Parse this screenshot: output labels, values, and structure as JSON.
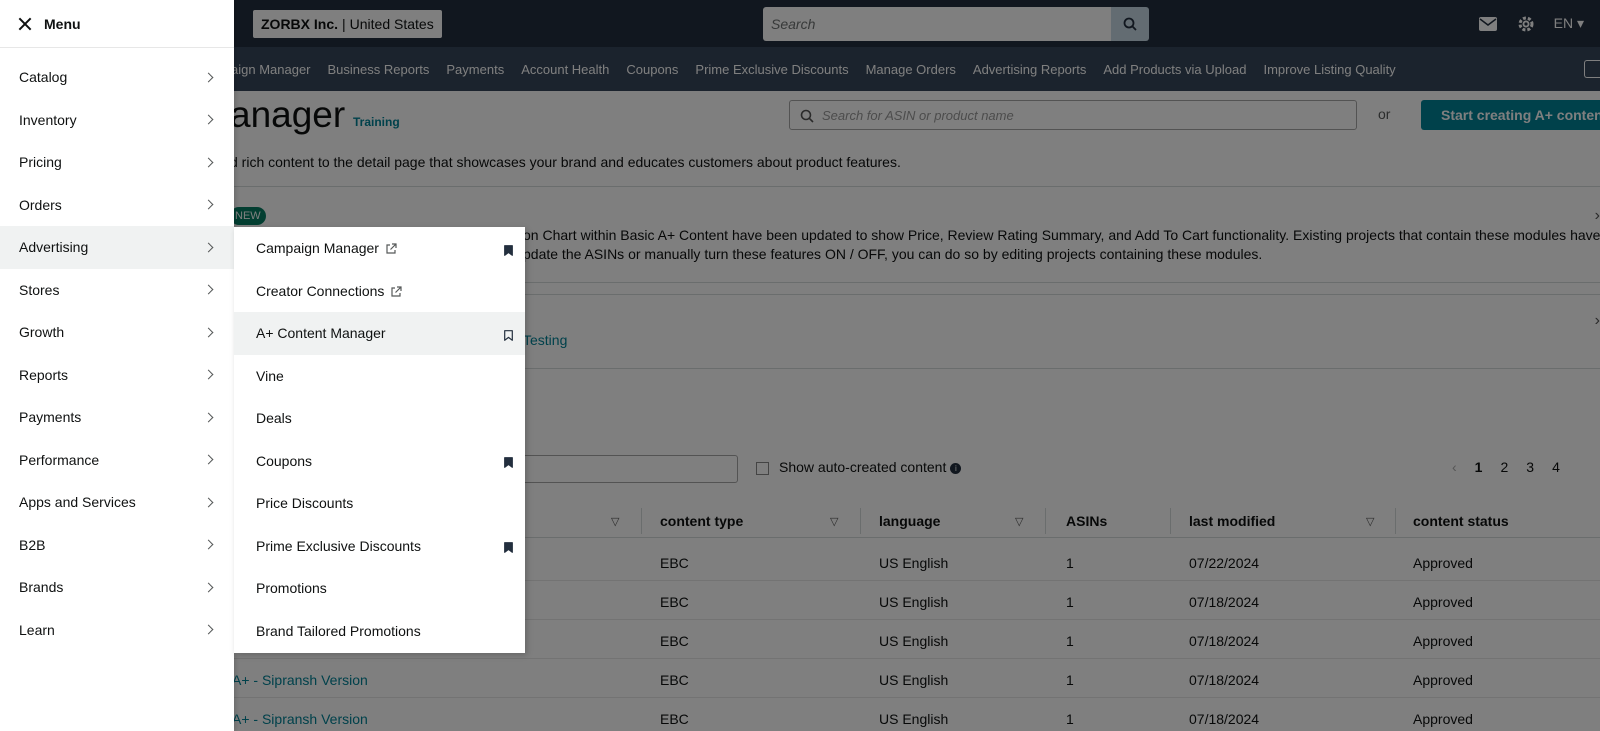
{
  "header": {
    "store_name": "ZORBX Inc.",
    "store_region": "United States",
    "search_placeholder": "Search",
    "language": "EN"
  },
  "nav": {
    "links": [
      "aign Manager",
      "Business Reports",
      "Payments",
      "Account Health",
      "Coupons",
      "Prime Exclusive Discounts",
      "Manage Orders",
      "Advertising Reports",
      "Add Products via Upload",
      "Improve Listing Quality"
    ]
  },
  "main": {
    "title": "anager",
    "training": "Training",
    "asin_search_placeholder": "Search for ASIN or product name",
    "or": "or",
    "start_button": "Start creating A+ conten",
    "description": "d rich content to the detail page that showcases your brand and educates customers about product features.",
    "new_badge": "NEW",
    "banner_line1": "on Chart within Basic A+ Content have been updated to show Price, Review Rating Summary, and Add To Cart functionality. Existing projects that contain these modules have",
    "banner_line2": "pdate the ASINs or manually turn these features ON / OFF, you can do so by editing projects containing these modules.",
    "testing": "Testing",
    "show_auto": "Show auto-created content",
    "pages": [
      "1",
      "2",
      "3",
      "4"
    ]
  },
  "table": {
    "headers": [
      "content type",
      "language",
      "ASINs",
      "last modified",
      "content status"
    ],
    "rows": [
      {
        "name": "",
        "type": "EBC",
        "language": "US English",
        "asins": "1",
        "modified": "07/22/2024",
        "status": "Approved"
      },
      {
        "name": "",
        "type": "EBC",
        "language": "US English",
        "asins": "1",
        "modified": "07/18/2024",
        "status": "Approved"
      },
      {
        "name": "",
        "type": "EBC",
        "language": "US English",
        "asins": "1",
        "modified": "07/18/2024",
        "status": "Approved"
      },
      {
        "name": "A+ - Sipransh Version",
        "type": "EBC",
        "language": "US English",
        "asins": "1",
        "modified": "07/18/2024",
        "status": "Approved"
      },
      {
        "name": "A+ - Sipransh Version",
        "type": "EBC",
        "language": "US English",
        "asins": "1",
        "modified": "07/18/2024",
        "status": "Approved"
      }
    ]
  },
  "drawer": {
    "title": "Menu",
    "items": [
      {
        "label": "Catalog"
      },
      {
        "label": "Inventory"
      },
      {
        "label": "Pricing"
      },
      {
        "label": "Orders"
      },
      {
        "label": "Advertising"
      },
      {
        "label": "Stores"
      },
      {
        "label": "Growth"
      },
      {
        "label": "Reports"
      },
      {
        "label": "Payments"
      },
      {
        "label": "Performance"
      },
      {
        "label": "Apps and Services"
      },
      {
        "label": "B2B"
      },
      {
        "label": "Brands"
      },
      {
        "label": "Learn"
      }
    ],
    "active_index": 4
  },
  "flyout": {
    "items": [
      {
        "label": "Campaign Manager",
        "external": true,
        "bookmark": "filled"
      },
      {
        "label": "Creator Connections",
        "external": true,
        "bookmark": "none"
      },
      {
        "label": "A+ Content Manager",
        "external": false,
        "bookmark": "outline"
      },
      {
        "label": "Vine",
        "external": false,
        "bookmark": "none"
      },
      {
        "label": "Deals",
        "external": false,
        "bookmark": "none"
      },
      {
        "label": "Coupons",
        "external": false,
        "bookmark": "filled"
      },
      {
        "label": "Price Discounts",
        "external": false,
        "bookmark": "none"
      },
      {
        "label": "Prime Exclusive Discounts",
        "external": false,
        "bookmark": "filled"
      },
      {
        "label": "Promotions",
        "external": false,
        "bookmark": "none"
      },
      {
        "label": "Brand Tailored Promotions",
        "external": false,
        "bookmark": "none"
      }
    ],
    "active_index": 2
  },
  "colors": {
    "topbar": "#232f3e",
    "navbar": "#37475a",
    "accent": "#008296",
    "active_bg": "#f0f2f2"
  }
}
